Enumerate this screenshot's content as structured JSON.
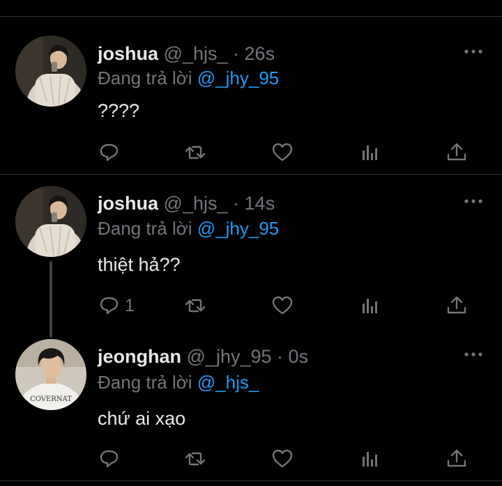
{
  "tweets": [
    {
      "name": "joshua",
      "handle": "@_hjs_",
      "dot": "·",
      "time": "26s",
      "reply_prefix": "Đang trả lời",
      "reply_to": "@_jhy_95",
      "text": "????",
      "reply_count": "",
      "avatar": "joshua-avatar"
    },
    {
      "name": "joshua",
      "handle": "@_hjs_",
      "dot": "·",
      "time": "14s",
      "reply_prefix": "Đang trả lời",
      "reply_to": "@_jhy_95",
      "text": "thiệt hả??",
      "reply_count": "1",
      "avatar": "joshua-avatar"
    },
    {
      "name": "jeonghan",
      "handle": "@_jhy_95",
      "dot": "·",
      "time": "0s",
      "reply_prefix": "Đang trả lời",
      "reply_to": "@_hjs_",
      "text": "chứ ai xạo",
      "reply_count": "",
      "avatar": "jeonghan-avatar"
    }
  ],
  "icons": {
    "reply": "reply-icon",
    "retweet": "retweet-icon",
    "like": "heart-icon",
    "views": "views-icon",
    "share": "share-icon",
    "more": "more-icon"
  },
  "colors": {
    "background": "#000000",
    "text": "#e7e9ea",
    "muted": "#71767b",
    "accent": "#1d9bf0",
    "divider": "#2f3336"
  }
}
